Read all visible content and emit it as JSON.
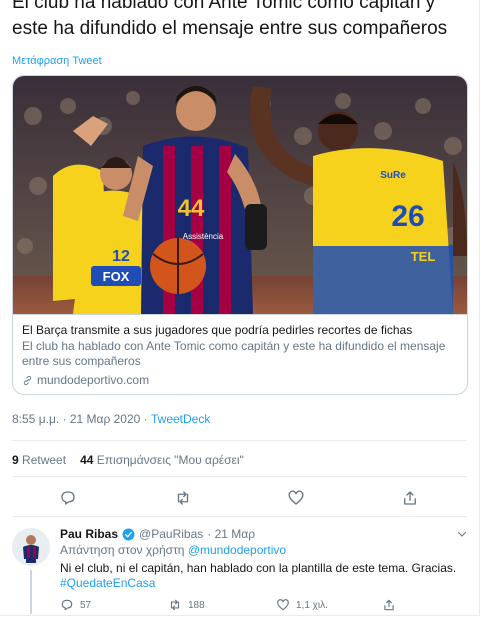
{
  "tweet": {
    "text": "El club ha hablado con Ante Tomic como capitán y este ha difundido el mensaje entre sus compañeros",
    "translate_label": "Μετάφραση Tweet"
  },
  "card": {
    "title": "El Barça transmite a sus jugadores que podría pedirles recortes de fichas",
    "description": "El club ha hablado con Ante Tomic como capitán y este ha difundido el mensaje entre sus compañeros",
    "domain": "mundodeportivo.com",
    "image": {
      "jersey_left": "12",
      "jersey_center": "44",
      "jersey_right": "26",
      "sponsor_fox": "FOX",
      "sponsor_sure": "SuRe",
      "sponsor_tel": "TEL",
      "sponsor_assistencia": "Assistència"
    }
  },
  "meta": {
    "time": "8:55 μ.μ. · 21 Μαρ 2020 · ",
    "via": "TweetDeck"
  },
  "stats": {
    "retweets_count": "9",
    "retweets_label": "Retweet",
    "likes_count": "44",
    "likes_label": "Επισημάνσεις \"Μου αρέσει\""
  },
  "actions": [
    "reply-icon",
    "retweet-icon",
    "like-icon",
    "share-icon"
  ],
  "reply": {
    "name": "Pau Ribas",
    "handle": "@PauRibas",
    "date": "· 21 Μαρ",
    "replying_label": "Απάντηση στον χρήστη",
    "replying_to": "@mundodeportivo",
    "text": "Ni el club, ni el capitán, han hablado con la plantilla de este tema. Gracias.",
    "hashtag": "#QuedateEnCasa",
    "replies": "57",
    "retweets": "188",
    "likes": "1,1 χιλ."
  },
  "colors": {
    "link": "#1da1f2",
    "text": "#14171a",
    "secondary": "#657786",
    "border": "#e6ecf0",
    "maccabi_yellow": "#f7d21c",
    "barca_blue": "#1a2a6c",
    "barca_red": "#a50044"
  }
}
